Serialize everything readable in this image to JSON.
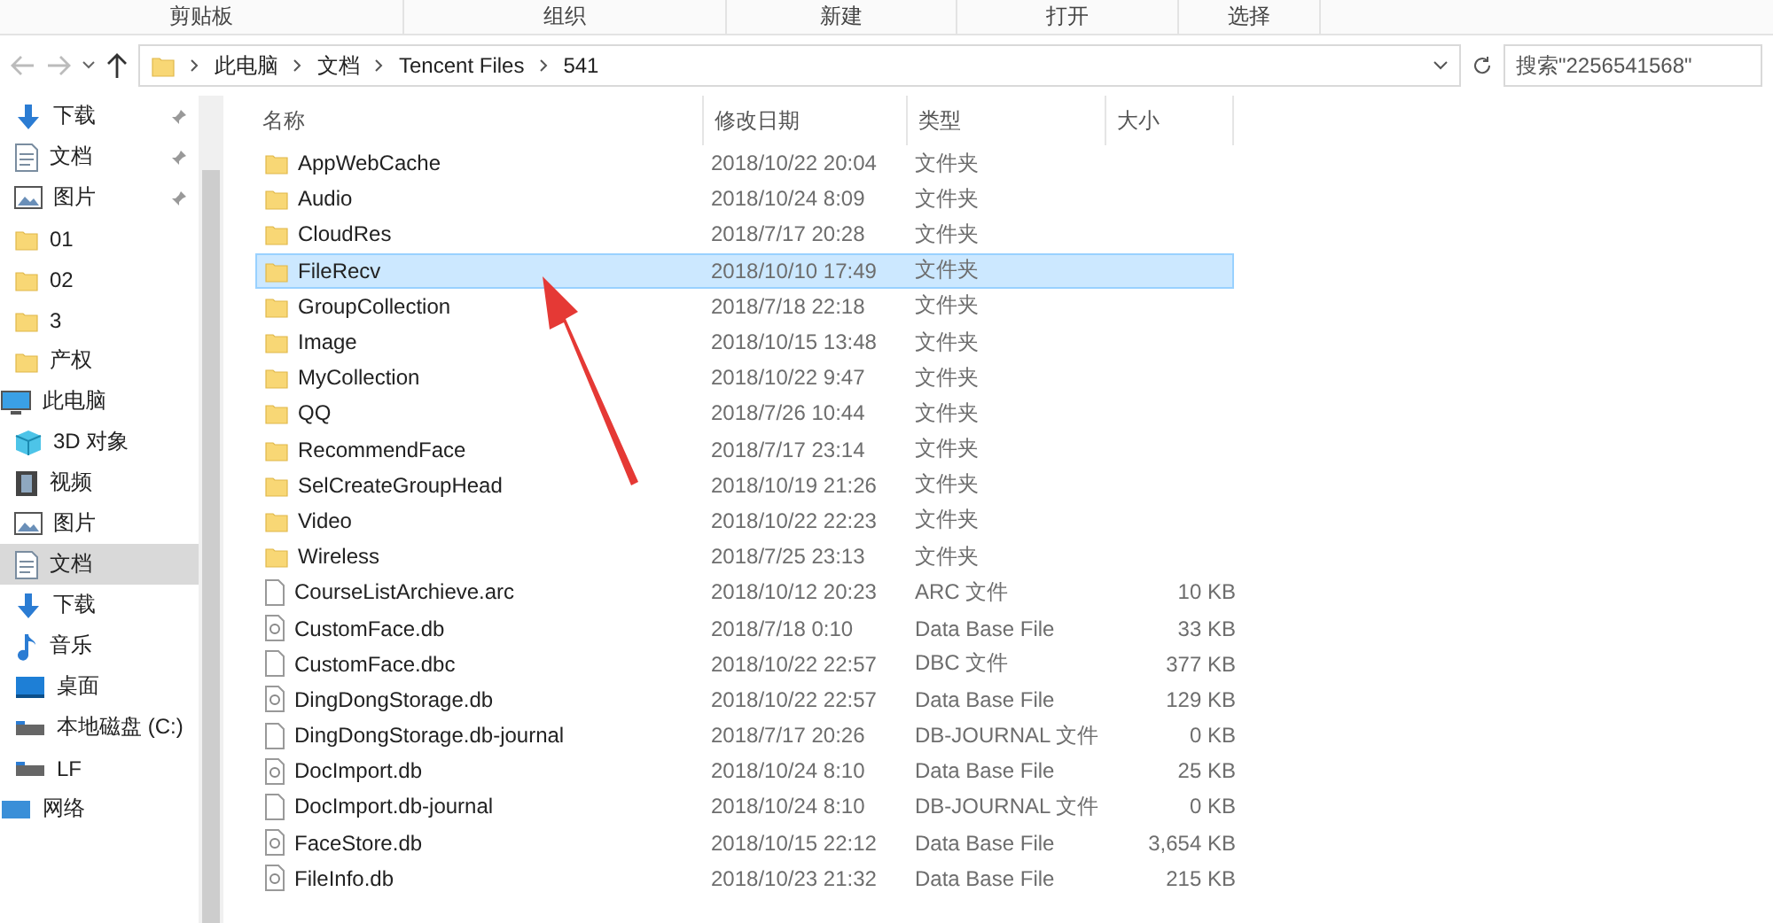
{
  "ribbon_groups": [
    "剪贴板",
    "组织",
    "新建",
    "打开",
    "选择"
  ],
  "address": {
    "path": [
      "此电脑",
      "文档",
      "Tencent Files",
      "541"
    ],
    "search_placeholder": "搜索\"2256541568\""
  },
  "sidebar": {
    "items": [
      {
        "label": "下载",
        "kind": "download",
        "pinned": true,
        "selected": false
      },
      {
        "label": "文档",
        "kind": "doc",
        "pinned": true,
        "selected": false
      },
      {
        "label": "图片",
        "kind": "picture",
        "pinned": true,
        "selected": false
      },
      {
        "label": "01",
        "kind": "folder",
        "pinned": false,
        "selected": false
      },
      {
        "label": "02",
        "kind": "folder",
        "pinned": false,
        "selected": false
      },
      {
        "label": "3",
        "kind": "folder",
        "pinned": false,
        "selected": false
      },
      {
        "label": "产权",
        "kind": "folder",
        "pinned": false,
        "selected": false
      },
      {
        "label": "此电脑",
        "kind": "pc",
        "pinned": false,
        "selected": false
      },
      {
        "label": "3D 对象",
        "kind": "cube",
        "pinned": false,
        "selected": false
      },
      {
        "label": "视频",
        "kind": "video",
        "pinned": false,
        "selected": false
      },
      {
        "label": "图片",
        "kind": "picture",
        "pinned": false,
        "selected": false
      },
      {
        "label": "文档",
        "kind": "doc",
        "pinned": false,
        "selected": true
      },
      {
        "label": "下载",
        "kind": "download",
        "pinned": false,
        "selected": false
      },
      {
        "label": "音乐",
        "kind": "music",
        "pinned": false,
        "selected": false
      },
      {
        "label": "桌面",
        "kind": "desktop",
        "pinned": false,
        "selected": false
      },
      {
        "label": "本地磁盘 (C:)",
        "kind": "drive",
        "pinned": false,
        "selected": false
      },
      {
        "label": "LF",
        "kind": "drive",
        "pinned": false,
        "selected": false
      },
      {
        "label": "网络",
        "kind": "network",
        "pinned": false,
        "selected": false
      }
    ]
  },
  "table": {
    "columns": [
      "名称",
      "修改日期",
      "类型",
      "大小"
    ],
    "rows": [
      {
        "name": "AppWebCache",
        "date": "2018/10/22 20:04",
        "type": "文件夹",
        "kind": "folder",
        "selected": false
      },
      {
        "name": "Audio",
        "date": "2018/10/24 8:09",
        "type": "文件夹",
        "kind": "folder",
        "selected": false
      },
      {
        "name": "CloudRes",
        "date": "2018/7/17 20:28",
        "type": "文件夹",
        "kind": "folder",
        "selected": false
      },
      {
        "name": "FileRecv",
        "date": "2018/10/10 17:49",
        "type": "文件夹",
        "kind": "folder",
        "selected": true
      },
      {
        "name": "GroupCollection",
        "date": "2018/7/18 22:18",
        "type": "文件夹",
        "kind": "folder",
        "selected": false
      },
      {
        "name": "Image",
        "date": "2018/10/15 13:48",
        "type": "文件夹",
        "kind": "folder",
        "selected": false
      },
      {
        "name": "MyCollection",
        "date": "2018/10/22 9:47",
        "type": "文件夹",
        "kind": "folder",
        "selected": false
      },
      {
        "name": "QQ",
        "date": "2018/7/26 10:44",
        "type": "文件夹",
        "kind": "folder",
        "selected": false
      },
      {
        "name": "RecommendFace",
        "date": "2018/7/17 23:14",
        "type": "文件夹",
        "kind": "folder",
        "selected": false
      },
      {
        "name": "SelCreateGroupHead",
        "date": "2018/10/19 21:26",
        "type": "文件夹",
        "kind": "folder",
        "selected": false
      },
      {
        "name": "Video",
        "date": "2018/10/22 22:23",
        "type": "文件夹",
        "kind": "folder",
        "selected": false
      },
      {
        "name": "Wireless",
        "date": "2018/7/25 23:13",
        "type": "文件夹",
        "kind": "folder",
        "selected": false
      },
      {
        "name": "CourseListArchieve.arc",
        "date": "2018/10/12 20:23",
        "type": "ARC 文件",
        "size": "10 KB",
        "kind": "file",
        "selected": false
      },
      {
        "name": "CustomFace.db",
        "date": "2018/7/18 0:10",
        "type": "Data Base File",
        "size": "33 KB",
        "kind": "db",
        "selected": false
      },
      {
        "name": "CustomFace.dbc",
        "date": "2018/10/22 22:57",
        "type": "DBC 文件",
        "size": "377 KB",
        "kind": "file",
        "selected": false
      },
      {
        "name": "DingDongStorage.db",
        "date": "2018/10/22 22:57",
        "type": "Data Base File",
        "size": "129 KB",
        "kind": "db",
        "selected": false
      },
      {
        "name": "DingDongStorage.db-journal",
        "date": "2018/7/17 20:26",
        "type": "DB-JOURNAL 文件",
        "size": "0 KB",
        "kind": "file",
        "selected": false
      },
      {
        "name": "DocImport.db",
        "date": "2018/10/24 8:10",
        "type": "Data Base File",
        "size": "25 KB",
        "kind": "db",
        "selected": false
      },
      {
        "name": "DocImport.db-journal",
        "date": "2018/10/24 8:10",
        "type": "DB-JOURNAL 文件",
        "size": "0 KB",
        "kind": "file",
        "selected": false
      },
      {
        "name": "FaceStore.db",
        "date": "2018/10/15 22:12",
        "type": "Data Base File",
        "size": "3,654 KB",
        "kind": "db",
        "selected": false
      },
      {
        "name": "FileInfo.db",
        "date": "2018/10/23 21:32",
        "type": "Data Base File",
        "size": "215 KB",
        "kind": "db",
        "selected": false
      }
    ]
  }
}
